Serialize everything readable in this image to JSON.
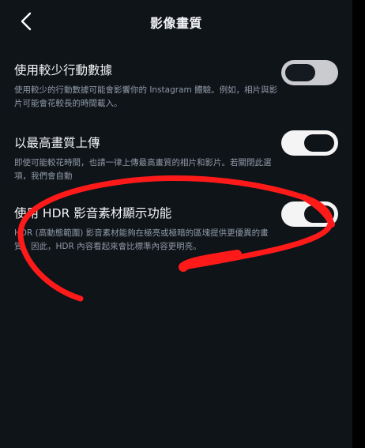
{
  "header": {
    "title": "影像畫質",
    "back_icon": "chevron-left-icon"
  },
  "settings": [
    {
      "label": "使用較少行動數據",
      "description": "使用較少的行動數據可能會影響你的 Instagram 體驗。例如，相片與影片可能會花較長的時間載入。",
      "toggle_state": "off"
    },
    {
      "label": "以最高畫質上傳",
      "description": "即使可能較花時間，也請一律上傳最高畫質的相片和影片。若關閉此選項，我們會自動",
      "toggle_state": "on"
    },
    {
      "label": "使用 HDR 影音素材顯示功能",
      "description": "HDR (高動態範圍) 影音素材能夠在極亮或極暗的區塊提供更優異的畫質。因此，HDR 內容看起來會比標準內容更明亮。",
      "toggle_state": "on"
    }
  ],
  "colors": {
    "background": "#0f1419",
    "annotation": "#ff1a1a",
    "toggle_on": "#f4f4f4",
    "toggle_off": "#c9cbcf"
  }
}
